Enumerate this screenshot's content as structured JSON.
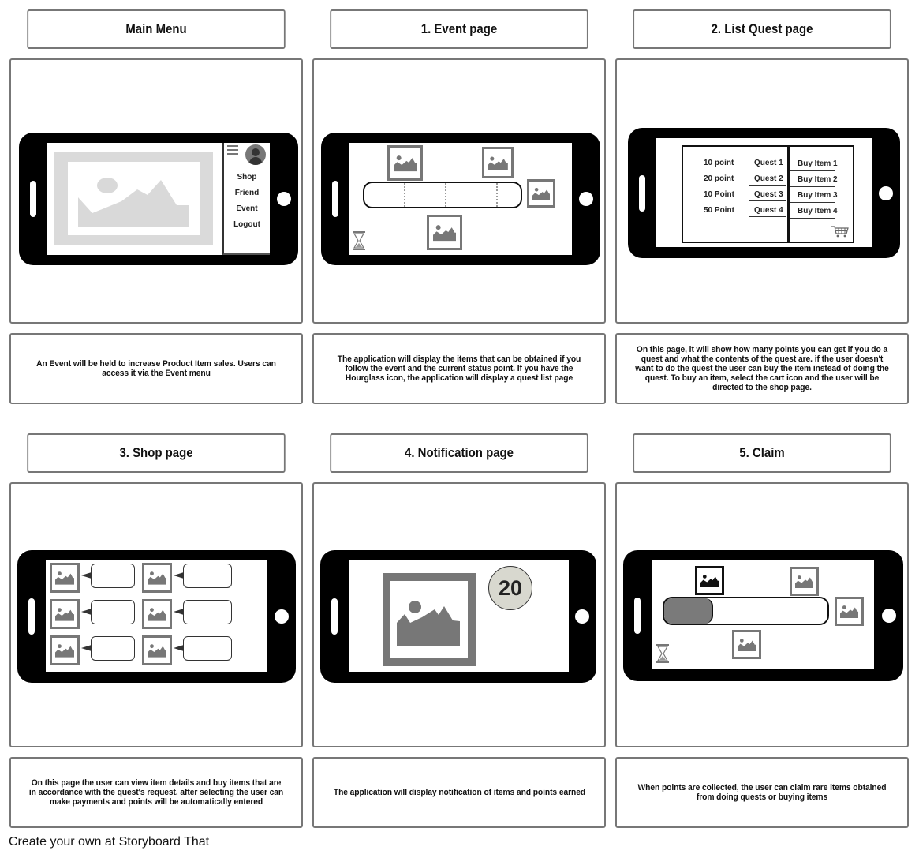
{
  "panels": [
    {
      "title": "Main Menu",
      "description": "An Event will be held to increase Product Item sales. Users can access it via the Event menu",
      "scene": {
        "menu_items": [
          "Shop",
          "Friend",
          "Event",
          "Logout"
        ],
        "icons": [
          "hamburger-icon",
          "avatar-icon",
          "image-placeholder-icon"
        ]
      }
    },
    {
      "title": "1. Event page",
      "description": "The application will display the items that can be obtained if you follow the event and the current status point. If you have the Hourglass icon, the application will display a quest list page",
      "scene": {
        "icons": [
          "image-placeholder-icon",
          "hourglass-icon"
        ],
        "progress": 0
      }
    },
    {
      "title": "2. List Quest page",
      "description": "On this page, it will show how many points you can get if you do a quest and what the contents of the quest are. if the user doesn't want to do the quest the user can buy the item instead of doing the quest. To buy an item, select the cart icon and the user will be directed to the shop page.",
      "scene": {
        "quests": [
          {
            "points": "10 point",
            "quest": "Quest 1",
            "buy": "Buy Item 1"
          },
          {
            "points": "20 point",
            "quest": "Quest 2",
            "buy": "Buy Item 2"
          },
          {
            "points": "10 Point",
            "quest": "Quest 3",
            "buy": "Buy Item 3"
          },
          {
            "points": "50 Point",
            "quest": "Quest 4",
            "buy": "Buy Item 4"
          }
        ],
        "icons": [
          "cart-icon"
        ]
      }
    },
    {
      "title": "3. Shop page",
      "description": "On this page the user can view item details and buy items that are in accordance with the quest's request. after selecting the user can make payments and points will be automatically entered",
      "scene": {
        "item_count": 6,
        "icons": [
          "image-placeholder-icon",
          "speech-bubble"
        ]
      }
    },
    {
      "title": "4. Notification page",
      "description": "The application will display notification of items and points earned",
      "scene": {
        "points_badge": "20",
        "badge_color": "#d8d8cf",
        "icons": [
          "image-placeholder-icon"
        ]
      }
    },
    {
      "title": "5. Claim",
      "description": "When points are collected, the user can claim rare items obtained from doing quests or buying items",
      "scene": {
        "progress": 0.3,
        "progress_color": "#7a7a7a",
        "icons": [
          "image-placeholder-icon",
          "hourglass-icon"
        ]
      }
    }
  ],
  "footer": "Create your own at Storyboard That"
}
